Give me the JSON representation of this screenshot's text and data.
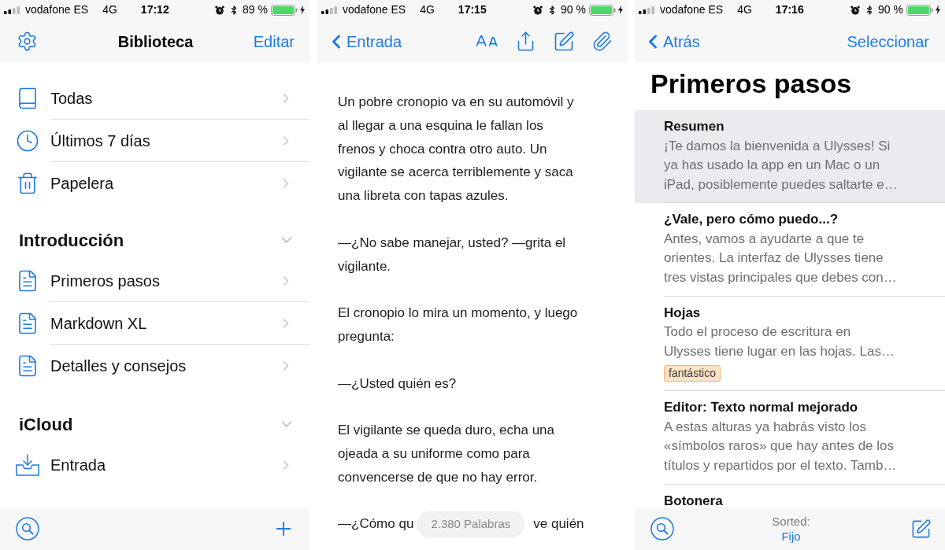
{
  "library_screen": {
    "status_bar": {
      "carrier": "vodafone ES",
      "network": "4G",
      "time": "17:12",
      "battery": "89 %"
    },
    "nav": {
      "title": "Biblioteca",
      "edit": "Editar"
    },
    "filters": [
      "Todas",
      "Últimos 7 días",
      "Papelera"
    ],
    "sections": [
      {
        "title": "Introducción",
        "expanded": true,
        "items": [
          "Primeros pasos",
          "Markdown XL",
          "Detalles y consejos"
        ]
      },
      {
        "title": "iCloud",
        "expanded": true,
        "items": [
          "Entrada"
        ]
      }
    ]
  },
  "editor_screen": {
    "status_bar": {
      "carrier": "vodafone ES",
      "network": "4G",
      "time": "17:15",
      "battery": "90 %"
    },
    "nav": {
      "back": "Entrada"
    },
    "paragraphs": [
      "Un pobre cronopio va en su automóvil y\nal llegar a una esquina le fallan los\nfrenos y choca contra otro auto. Un\nvigilante se acerca terriblemente y saca\nuna libreta con tapas azules.",
      "—¿No sabe manejar, usted? —grita el\nvigilante.",
      "El cronopio lo mira un momento, y luego\npregunta:",
      "—¿Usted quién es?",
      "El vigilante se queda duro, echa una\nojeada a su uniforme como para\nconvencerse de que no hay error."
    ],
    "covered_line": {
      "before": "—¿Cómo qu",
      "after": "ve quién"
    },
    "word_count": "2.380 Palabras"
  },
  "sheets_screen": {
    "status_bar": {
      "carrier": "vodafone ES",
      "network": "4G",
      "time": "17:16",
      "battery": "90 %"
    },
    "nav": {
      "back": "Atrás",
      "action": "Seleccionar"
    },
    "title": "Primeros pasos",
    "sheets": [
      {
        "title": "Resumen",
        "preview": "¡Te damos la bienvenida a Ulysses! Si\nya has usado la app en un Mac o un\niPad, posiblemente puedes saltarte e…",
        "selected": true
      },
      {
        "title": "¿Vale, pero cómo puedo...?",
        "preview": "Antes, vamos a ayudarte a que te\norientes. La interfaz de Ulysses tiene\ntres vistas principales que debes con…",
        "selected": false
      },
      {
        "title": "Hojas",
        "preview": "Todo el proceso de escritura en\nUlysses tiene lugar en las hojas. Las…",
        "tags": [
          "fantástico"
        ],
        "selected": false
      },
      {
        "title": "Editor: Texto normal mejorado",
        "preview": "A estas alturas ya habrás visto los\n«símbolos raros» que hay antes de los\ntítulos y repartidos por el texto. Tamb…",
        "selected": false
      },
      {
        "title": "Botonera",
        "selected": false
      }
    ],
    "toolbar": {
      "label": "Sorted:",
      "value": "Fijo"
    }
  }
}
